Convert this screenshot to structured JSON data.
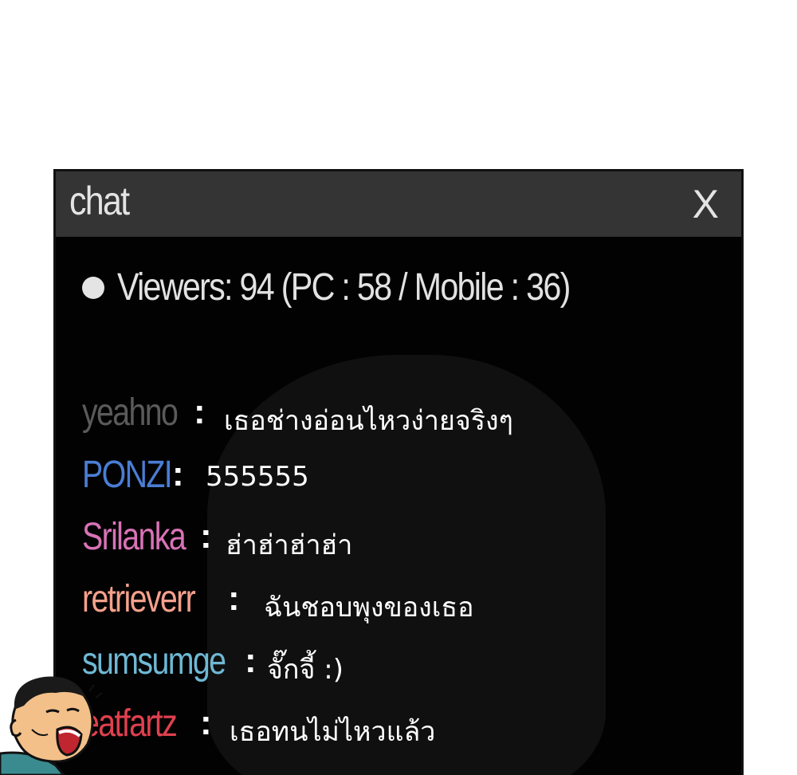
{
  "window": {
    "title": "chat",
    "close_label": "X"
  },
  "viewers": {
    "text": "Viewers: 94 (PC : 58 / Mobile : 36)"
  },
  "messages": [
    {
      "user": "yeahno",
      "separator": ":",
      "text": "เธอช่างอ่อนไหวง่ายจริงๆ",
      "color": "#5a5a5a"
    },
    {
      "user": "PONZI",
      "separator": ":",
      "text": "555555",
      "color": "#4a7dd4"
    },
    {
      "user": "Srilanka",
      "separator": ":",
      "text": "ฮ่าฮ่าฮ่าฮ่า",
      "color": "#d873b6"
    },
    {
      "user": "retrieverr",
      "separator": ":",
      "text": "ฉันชอบพุงของเธอ",
      "color": "#f5a08c"
    },
    {
      "user": "sumsumge",
      "separator": ":",
      "text": "จั๊กจี้ :)",
      "color": "#6fb8d4"
    },
    {
      "user": "eatfartz",
      "separator": ":",
      "text": "เธอทนไม่ไหวแล้ว",
      "color": "#e0404e"
    }
  ],
  "icons": {
    "viewer_dot": "dot-icon",
    "avatar": "laughing-man-avatar"
  }
}
